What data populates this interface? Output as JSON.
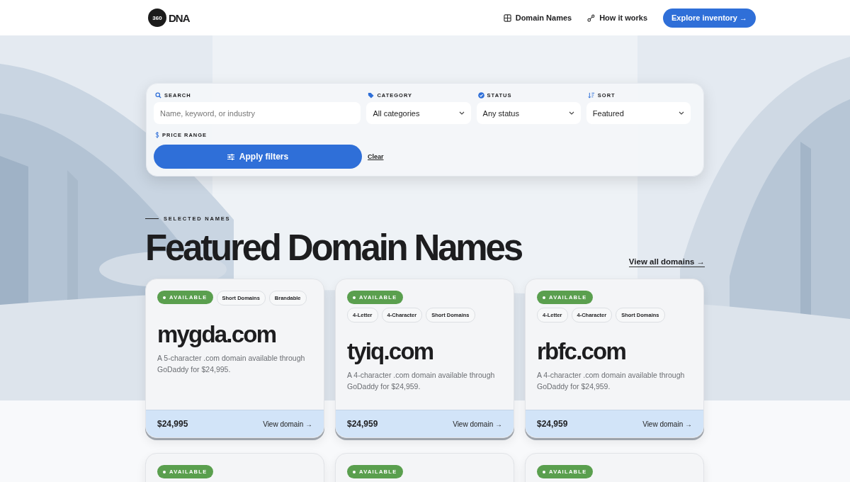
{
  "header": {
    "logo_badge": "360",
    "logo_text": "DNA",
    "nav": [
      {
        "label": "Domain Names"
      },
      {
        "label": "How it works"
      }
    ],
    "cta": "Explore inventory →"
  },
  "filters": {
    "fields": [
      {
        "kind": "input",
        "label": "SEARCH",
        "placeholder": "Name, keyword, or industry"
      },
      {
        "kind": "select",
        "label": "CATEGORY",
        "value": "All categories"
      },
      {
        "kind": "select",
        "label": "STATUS",
        "value": "Any status"
      },
      {
        "kind": "select",
        "label": "SORT",
        "value": "Featured"
      }
    ],
    "price_label": "PRICE RANGE",
    "apply": "Apply filters",
    "clear": "Clear"
  },
  "section": {
    "eyebrow": "SELECTED NAMES",
    "title": "Featured Domain Names",
    "view_all": "View all domains →"
  },
  "cards": [
    {
      "status": "AVAILABLE",
      "tags": [
        "Short Domains",
        "Brandable"
      ],
      "name": "mygda.com",
      "description": "A 5-character .com domain available through GoDaddy for $24,995.",
      "price": "$24,995",
      "link": "View domain →"
    },
    {
      "status": "AVAILABLE",
      "tags": [
        "4-Letter",
        "4-Character",
        "Short Domains"
      ],
      "name": "tyiq.com",
      "description": "A 4-character .com domain available through GoDaddy for $24,959.",
      "price": "$24,959",
      "link": "View domain →"
    },
    {
      "status": "AVAILABLE",
      "tags": [
        "4-Letter",
        "4-Character",
        "Short Domains"
      ],
      "name": "rbfc.com",
      "description": "A 4-character .com domain available through GoDaddy for $24,959.",
      "price": "$24,959",
      "link": "View domain →"
    },
    {
      "status": "AVAILABLE"
    },
    {
      "status": "AVAILABLE"
    },
    {
      "status": "AVAILABLE"
    }
  ]
}
